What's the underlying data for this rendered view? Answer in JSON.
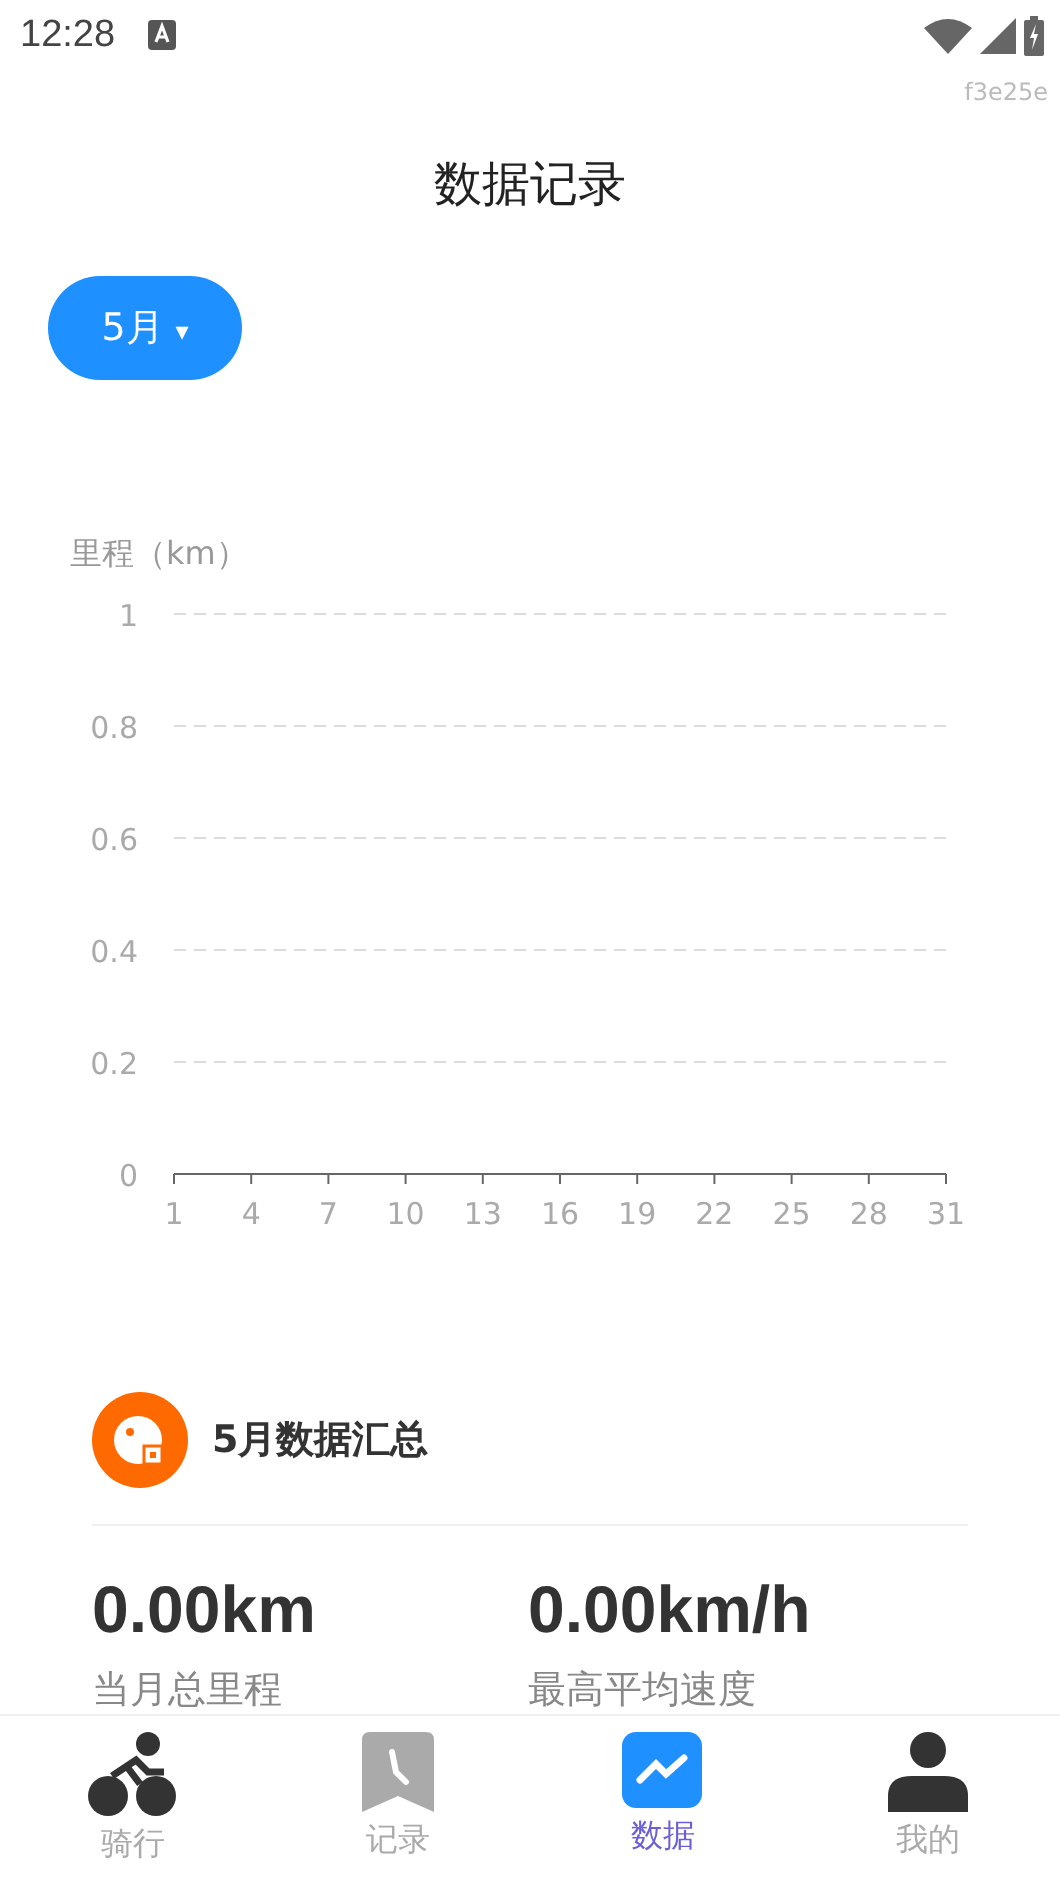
{
  "status_bar": {
    "time": "12:28",
    "debug_text": "f3e25e"
  },
  "title": "数据记录",
  "month_picker": {
    "label": "5月",
    "caret": "▾"
  },
  "chart": {
    "chart_data": {
      "type": "line",
      "ylabel": "里程（km）",
      "xlim": [
        1,
        31
      ],
      "ylim": [
        0,
        1
      ],
      "xticks": [
        1,
        4,
        7,
        10,
        13,
        16,
        19,
        22,
        25,
        28,
        31
      ],
      "yticks": [
        0,
        0.2,
        0.4,
        0.6,
        0.8,
        1
      ],
      "grid": true
    }
  },
  "summary": {
    "title": "5月数据汇总",
    "stats": [
      {
        "value": "0.00km",
        "label": "当月总里程"
      },
      {
        "value": "0.00km/h",
        "label": "最高平均速度"
      }
    ]
  },
  "tab_bar": [
    {
      "kind": "ride",
      "label": "骑行",
      "selected": false
    },
    {
      "kind": "record",
      "label": "记录",
      "selected": false
    },
    {
      "kind": "data",
      "label": "数据",
      "selected": true
    },
    {
      "kind": "me",
      "label": "我的",
      "selected": false
    }
  ]
}
